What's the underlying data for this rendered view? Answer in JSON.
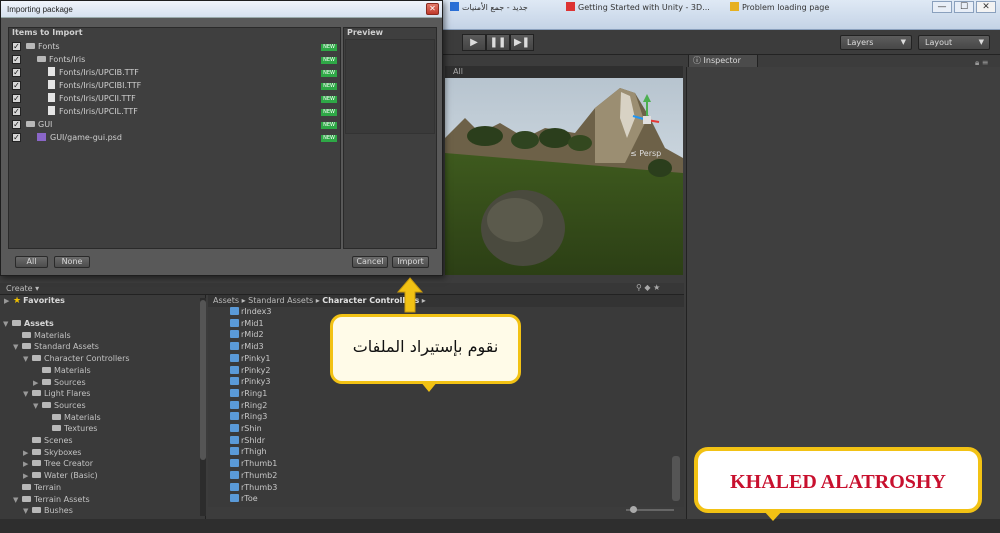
{
  "browser_tabs": [
    {
      "label": "جديد - جمع الأمنيات",
      "icon": "blue"
    },
    {
      "label": "Getting Started with Unity - 3D...",
      "icon": "red"
    },
    {
      "label": "Problem loading page",
      "icon": "yellow"
    }
  ],
  "window_controls": {
    "minimize": "—",
    "maximize": "☐",
    "close": "✕"
  },
  "toolbar": {
    "play": "▶",
    "pause": "❚❚",
    "step": "▶❚",
    "layers_label": "Layers",
    "layout_label": "Layout"
  },
  "scene": {
    "search_placeholder": "All",
    "persp_label": "≤ Persp"
  },
  "inspector": {
    "tab_label": "Inspector"
  },
  "dialog": {
    "title": "Importing package",
    "items_header": "Items to Import",
    "preview_header": "Preview",
    "items": [
      {
        "label": "Fonts",
        "level": 0,
        "type": "folder",
        "new": "NEW"
      },
      {
        "label": "Fonts/Iris",
        "level": 1,
        "type": "folder",
        "new": "NEW"
      },
      {
        "label": "Fonts/Iris/UPCIB.TTF",
        "level": 2,
        "type": "file",
        "new": "NEW"
      },
      {
        "label": "Fonts/Iris/UPCIBI.TTF",
        "level": 2,
        "type": "file",
        "new": "NEW"
      },
      {
        "label": "Fonts/Iris/UPCII.TTF",
        "level": 2,
        "type": "file",
        "new": "NEW"
      },
      {
        "label": "Fonts/Iris/UPCIL.TTF",
        "level": 2,
        "type": "file",
        "new": "NEW"
      },
      {
        "label": "GUI",
        "level": 0,
        "type": "folder",
        "new": "NEW"
      },
      {
        "label": "GUI/game-gui.psd",
        "level": 1,
        "type": "psd",
        "new": "NEW"
      }
    ],
    "buttons": {
      "all": "All",
      "none": "None",
      "cancel": "Cancel",
      "import": "Import"
    }
  },
  "project": {
    "create_label": "Create ▾",
    "favorites_label": "Favorites",
    "tree": [
      {
        "label": "Assets",
        "level": 0,
        "arrow": "▼",
        "bold": true
      },
      {
        "label": "Materials",
        "level": 1,
        "arrow": ""
      },
      {
        "label": "Standard Assets",
        "level": 1,
        "arrow": "▼"
      },
      {
        "label": "Character Controllers",
        "level": 2,
        "arrow": "▼"
      },
      {
        "label": "Materials",
        "level": 3,
        "arrow": ""
      },
      {
        "label": "Sources",
        "level": 3,
        "arrow": "▶"
      },
      {
        "label": "Light Flares",
        "level": 2,
        "arrow": "▼"
      },
      {
        "label": "Sources",
        "level": 3,
        "arrow": "▼"
      },
      {
        "label": "Materials",
        "level": 4,
        "arrow": ""
      },
      {
        "label": "Textures",
        "level": 4,
        "arrow": ""
      },
      {
        "label": "Scenes",
        "level": 2,
        "arrow": ""
      },
      {
        "label": "Skyboxes",
        "level": 2,
        "arrow": "▶"
      },
      {
        "label": "Tree Creator",
        "level": 2,
        "arrow": "▶"
      },
      {
        "label": "Water (Basic)",
        "level": 2,
        "arrow": "▶"
      },
      {
        "label": "Terrain",
        "level": 1,
        "arrow": ""
      },
      {
        "label": "Terrain Assets",
        "level": 1,
        "arrow": "▼"
      },
      {
        "label": "Bushes",
        "level": 2,
        "arrow": "▼"
      }
    ],
    "breadcrumbs": [
      "Assets",
      "Standard Assets",
      "Character Controllers"
    ],
    "files": [
      "rIndex3",
      "rMid1",
      "rMid2",
      "rMid3",
      "rPinky1",
      "rPinky2",
      "rPinky3",
      "rRing1",
      "rRing2",
      "rRing3",
      "rShin",
      "rShldr",
      "rThigh",
      "rThumb1",
      "rThumb2",
      "rThumb3",
      "rToe"
    ]
  },
  "callouts": {
    "import_note": "نقوم بإستيراد الملفات",
    "author": "KHALED ALATROSHY"
  },
  "colors": {
    "accent_yellow": "#f2c214",
    "author_red": "#c8102e",
    "new_badge": "#2ea846"
  }
}
